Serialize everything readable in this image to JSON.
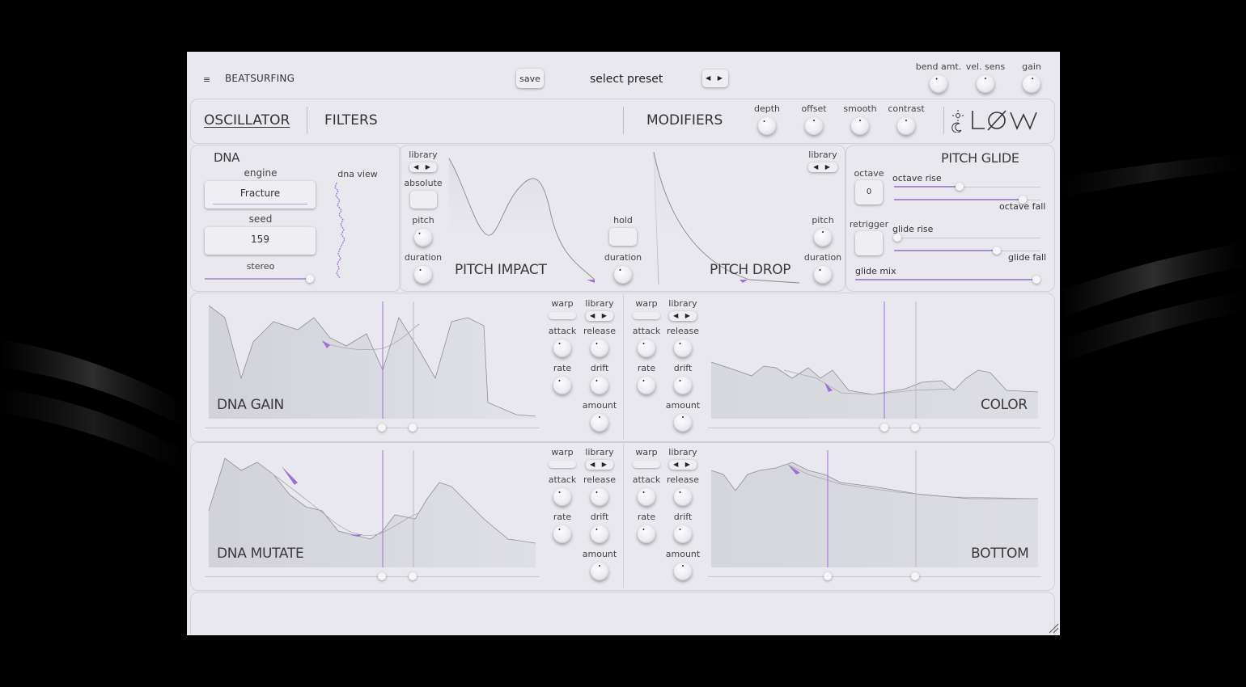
{
  "header": {
    "menu_icon": "hamburger-icon",
    "brand": "BEATSURFING",
    "save_label": "save",
    "preset_label": "select preset",
    "preset_arrows": "◀ ▶",
    "knobs": [
      {
        "label": "bend amt."
      },
      {
        "label": "vel. sens"
      },
      {
        "label": "gain"
      }
    ]
  },
  "tabs": {
    "oscillator": "OSCILLATOR",
    "filters": "FILTERS",
    "modifiers": "MODIFIERS",
    "mod_knobs": [
      {
        "label": "depth"
      },
      {
        "label": "offset"
      },
      {
        "label": "smooth"
      },
      {
        "label": "contrast"
      }
    ],
    "theme_icon": "sun-moon-icon",
    "logo": "LØW"
  },
  "dna": {
    "title": "DNA",
    "engine_label": "engine",
    "engine_value": "Fracture",
    "seed_label": "seed",
    "seed_value": "159",
    "stereo_label": "stereo",
    "stereo_level": 0.98,
    "view_label": "dna view"
  },
  "pitch_impact": {
    "library_label": "library",
    "library_arrows": "◀ ▶",
    "absolute_label": "absolute",
    "pitch_label": "pitch",
    "duration_label": "duration",
    "hold_label": "hold",
    "duration2_label": "duration",
    "title": "PITCH IMPACT"
  },
  "pitch_drop": {
    "library_label": "library",
    "library_arrows": "◀ ▶",
    "pitch_label": "pitch",
    "duration_label": "duration",
    "title": "PITCH DROP"
  },
  "pitch_glide": {
    "title": "PITCH GLIDE",
    "octave_label": "octave",
    "octave_value": "0",
    "retrigger_label": "retrigger",
    "octave_rise_label": "octave rise",
    "octave_fall_label": "octave fall",
    "glide_rise_label": "glide rise",
    "glide_fall_label": "glide fall",
    "glide_mix_label": "glide mix",
    "octave_rise_level": 0.45,
    "octave_fall_level": 0.88,
    "glide_rise_level": 0.02,
    "glide_fall_level": 0.7,
    "glide_mix_level": 0.98
  },
  "envelopes": [
    {
      "title": "DNA GAIN",
      "warp": "warp",
      "library": "library",
      "arrows": "◀ ▶",
      "attack": "attack",
      "release": "release",
      "rate": "rate",
      "drift": "drift",
      "amount": "amount"
    },
    {
      "title": "COLOR",
      "warp": "warp",
      "library": "library",
      "arrows": "◀ ▶",
      "attack": "attack",
      "release": "release",
      "rate": "rate",
      "drift": "drift",
      "amount": "amount"
    },
    {
      "title": "DNA MUTATE",
      "warp": "warp",
      "library": "library",
      "arrows": "◀ ▶",
      "attack": "attack",
      "release": "release",
      "rate": "rate",
      "drift": "drift",
      "amount": "amount"
    },
    {
      "title": "BOTTOM",
      "warp": "warp",
      "library": "library",
      "arrows": "◀ ▶",
      "attack": "attack",
      "release": "release",
      "rate": "rate",
      "drift": "drift",
      "amount": "amount"
    }
  ],
  "colors": {
    "accent": "#9b6fd6",
    "panel": "#e8e8ee",
    "background": "#000000"
  }
}
